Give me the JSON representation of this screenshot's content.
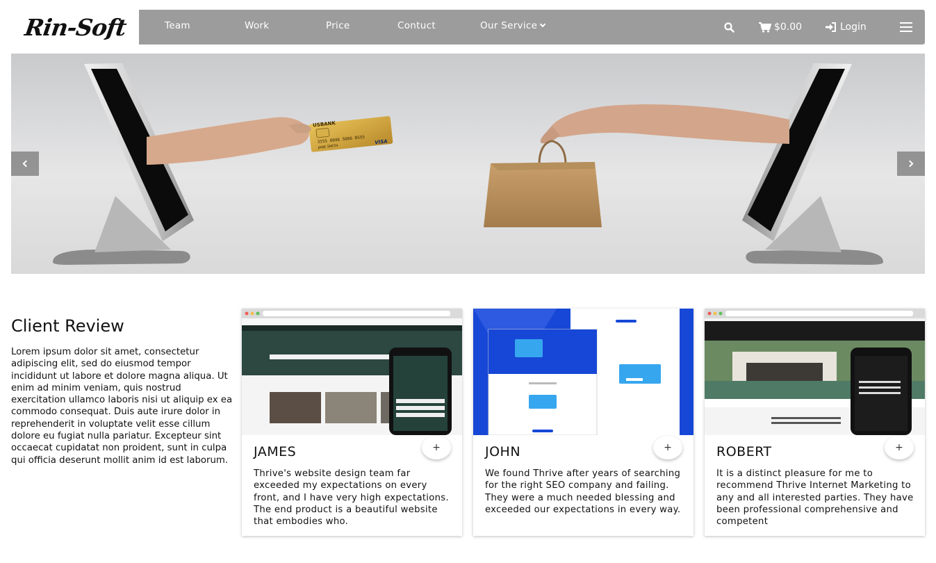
{
  "brand": {
    "logo_text": "Rin-Soft"
  },
  "nav": {
    "links": [
      "Team",
      "Work",
      "Price",
      "Contuct",
      "Our Service"
    ],
    "cart_total": "$0.00",
    "login_label": "Login",
    "icons": {
      "search": "search-icon",
      "cart": "cart-icon",
      "login": "sign-in-icon",
      "menu": "hamburger-menu-icon",
      "dropdown": "chevron-down-icon"
    }
  },
  "hero": {
    "controls": {
      "prev": "chevron-left-icon",
      "next": "chevron-right-icon"
    },
    "card_print": {
      "bank": "USBANK",
      "number": "3555 0046 5006 8555",
      "brand": "VISA",
      "holder": "JANE SMITH"
    }
  },
  "review": {
    "title": "Client Review",
    "text": "Lorem ipsum dolor sit amet, consectetur adipiscing elit, sed do eiusmod tempor incididunt ut labore et dolore magna aliqua. Ut enim ad minim veniam, quis nostrud exercitation ullamco laboris nisi ut aliquip ex ea commodo consequat. Duis aute irure dolor in reprehenderit in voluptate velit esse cillum dolore eu fugiat nulla pariatur. Excepteur sint occaecat cupidatat non proident, sunt in culpa qui officia deserunt mollit anim id est laborum."
  },
  "cards": [
    {
      "name": "JAMES",
      "plus": "+",
      "text": "Thrive's website design team far exceeded my expectations on every front, and I have very high expectations. The end product is a beautiful website that embodies who."
    },
    {
      "name": "JOHN",
      "plus": "+",
      "text": "We found Thrive after years of searching for the right SEO company and failing. They were a much needed blessing and exceeded our expectations in every way."
    },
    {
      "name": "ROBERT",
      "plus": "+",
      "text": "It is a distinct pleasure for me to recommend Thrive Internet Marketing to any and all interested parties. They have been professional comprehensive and competent"
    }
  ],
  "colors": {
    "navbar": "#9c9c9c",
    "card_blue": "#1747d6",
    "hero_bg": "#dcdcdd"
  }
}
